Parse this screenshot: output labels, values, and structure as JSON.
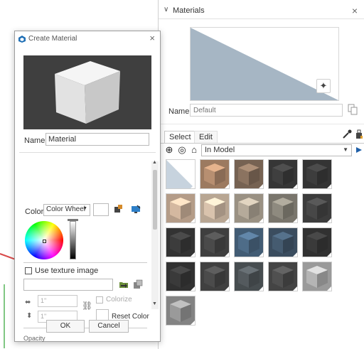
{
  "materials_panel": {
    "title": "Materials",
    "name_label": "Name",
    "name_placeholder": "Default",
    "tabs": [
      "Select",
      "Edit"
    ],
    "collection": "In Model",
    "swatch_colors": [
      [
        "#c7d3de",
        "#b78f71",
        "#8b7360",
        "#3f3f3f",
        "#3d3d3d"
      ],
      [
        "#d4b8a0",
        "#d9c3ad",
        "#b5aa9a",
        "#8e8a7f",
        "#474747"
      ],
      [
        "#3c3c3c",
        "#4a4a4a",
        "#4e6c88",
        "#455b70",
        "#3a3a3a"
      ],
      [
        "#3a3a3a",
        "#4b4b4b",
        "#545a5e",
        "#505050",
        "#b5b5b5"
      ],
      [
        "#9a9a9a"
      ]
    ]
  },
  "dialog": {
    "title": "Create Material",
    "name_label": "Name",
    "name_value": "Material",
    "color_label": "Color:",
    "color_mode": "Color Wheel",
    "use_texture_label": "Use texture image",
    "width_value": "1\"",
    "height_value": "1\"",
    "colorize_label": "Colorize",
    "reset_color_label": "Reset Color",
    "opacity_label": "Opacity",
    "ok_label": "OK",
    "cancel_label": "Cancel"
  }
}
